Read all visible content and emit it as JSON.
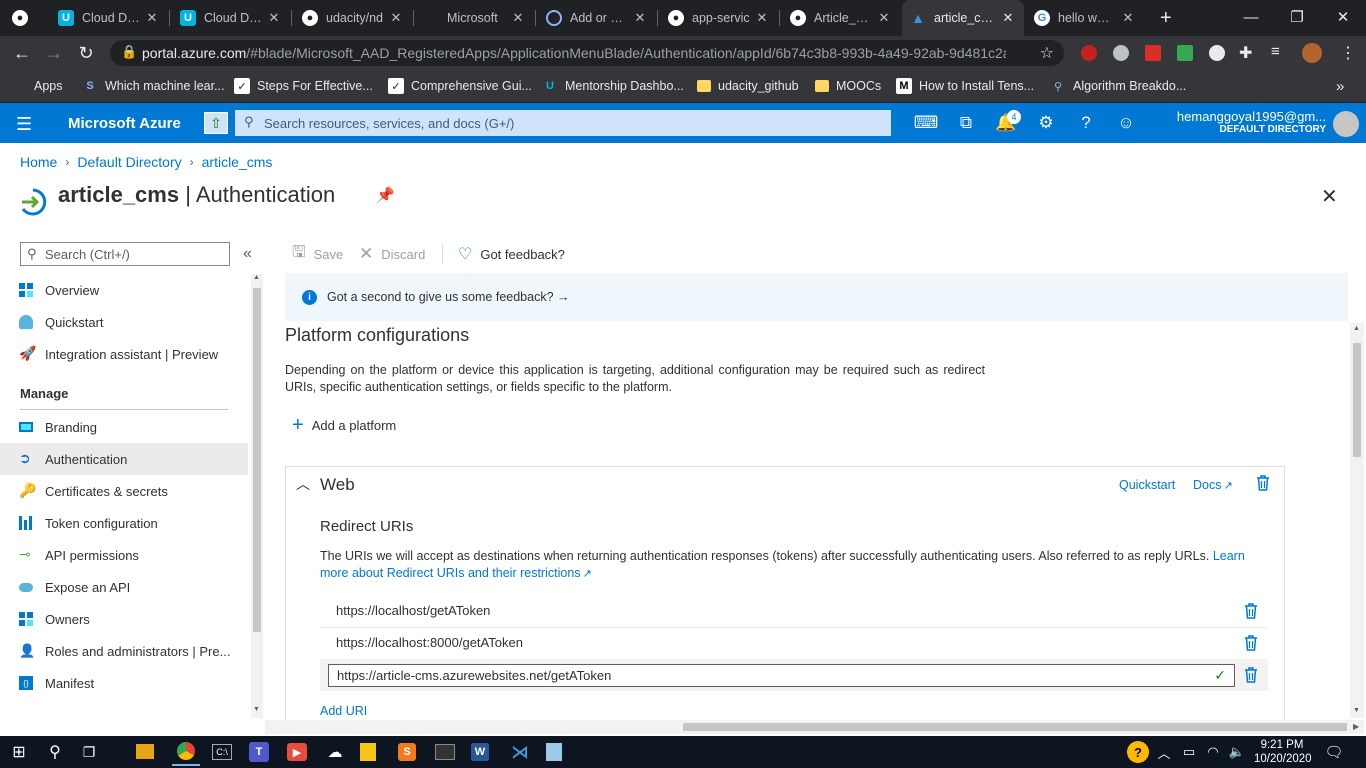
{
  "browser": {
    "tabs": [
      {
        "title": "Cloud Dev",
        "icon": "udacity-icon"
      },
      {
        "title": "Cloud Dev",
        "icon": "udacity-icon"
      },
      {
        "title": "udacity/nd",
        "icon": "github-icon"
      },
      {
        "title": "Microsoft",
        "icon": "microsoft-icon"
      },
      {
        "title": "Add or upd",
        "icon": "github-icon"
      },
      {
        "title": "app-servic",
        "icon": "github-icon"
      },
      {
        "title": "Article_CM",
        "icon": "github-icon"
      },
      {
        "title": "article_cms",
        "icon": "azure-icon"
      },
      {
        "title": "hello world",
        "icon": "google-icon"
      }
    ],
    "url_host": "portal.azure.com",
    "url_path": "/#blade/Microsoft_AAD_RegisteredApps/ApplicationMenuBlade/Authentication/appId/6b74c3b8-993b-4a49-92ab-9d481c2a...",
    "bookmarks": [
      {
        "label": "Apps"
      },
      {
        "label": "Which machine lear..."
      },
      {
        "label": "Steps For Effective..."
      },
      {
        "label": "Comprehensive Gui..."
      },
      {
        "label": "Mentorship Dashbo..."
      },
      {
        "label": "udacity_github"
      },
      {
        "label": "MOOCs"
      },
      {
        "label": "How to Install Tens..."
      },
      {
        "label": "Algorithm Breakdo..."
      }
    ]
  },
  "azure": {
    "brand": "Microsoft Azure",
    "search_placeholder": "Search resources, services, and docs (G+/)",
    "notifications_count": "4",
    "user_email": "hemanggoyal1995@gm...",
    "user_directory": "DEFAULT DIRECTORY"
  },
  "breadcrumb": [
    "Home",
    "Default Directory",
    "article_cms"
  ],
  "page": {
    "title_app": "article_cms",
    "title_section": "Authentication"
  },
  "sidebar": {
    "search_placeholder": "Search (Ctrl+/)",
    "items_top": [
      {
        "label": "Overview",
        "icon": "overview-icon"
      },
      {
        "label": "Quickstart",
        "icon": "quickstart-icon"
      },
      {
        "label": "Integration assistant | Preview",
        "icon": "rocket-icon"
      }
    ],
    "manage_header": "Manage",
    "items_manage": [
      {
        "label": "Branding",
        "icon": "branding-icon"
      },
      {
        "label": "Authentication",
        "icon": "authentication-icon",
        "selected": true
      },
      {
        "label": "Certificates & secrets",
        "icon": "key-icon"
      },
      {
        "label": "Token configuration",
        "icon": "token-icon"
      },
      {
        "label": "API permissions",
        "icon": "api-permissions-icon"
      },
      {
        "label": "Expose an API",
        "icon": "cloud-icon"
      },
      {
        "label": "Owners",
        "icon": "owners-icon"
      },
      {
        "label": "Roles and administrators | Pre...",
        "icon": "roles-icon"
      },
      {
        "label": "Manifest",
        "icon": "manifest-icon"
      }
    ]
  },
  "commands": {
    "save": "Save",
    "discard": "Discard",
    "feedback": "Got feedback?"
  },
  "banner": "Got a second to give us some feedback? →",
  "platform": {
    "heading": "Platform configurations",
    "description": "Depending on the platform or device this application is targeting, additional configuration may be required such as redirect URIs, specific authentication settings, or fields specific to the platform.",
    "add_platform": "Add a platform"
  },
  "web": {
    "title": "Web",
    "quickstart": "Quickstart",
    "docs": "Docs",
    "redirect_heading": "Redirect URIs",
    "redirect_desc": "The URIs we will accept as destinations when returning authentication responses (tokens) after successfully authenticating users. Also referred to as reply URLs.",
    "learn_more": "Learn more about Redirect URIs and their restrictions",
    "uris": [
      "https://localhost/getAToken",
      "https://localhost:8000/getAToken"
    ],
    "uri_input_value": "https://article-cms.azurewebsites.net/getAToken",
    "add_uri": "Add URI"
  },
  "taskbar": {
    "time": "9:21 PM",
    "date": "10/20/2020"
  },
  "colors": {
    "azure_blue": "#0078d4",
    "chrome_dark": "#202124",
    "chrome_toolbar": "#35363a",
    "selected_nav": "#edebe9",
    "banner_bg": "#eff6fc"
  }
}
